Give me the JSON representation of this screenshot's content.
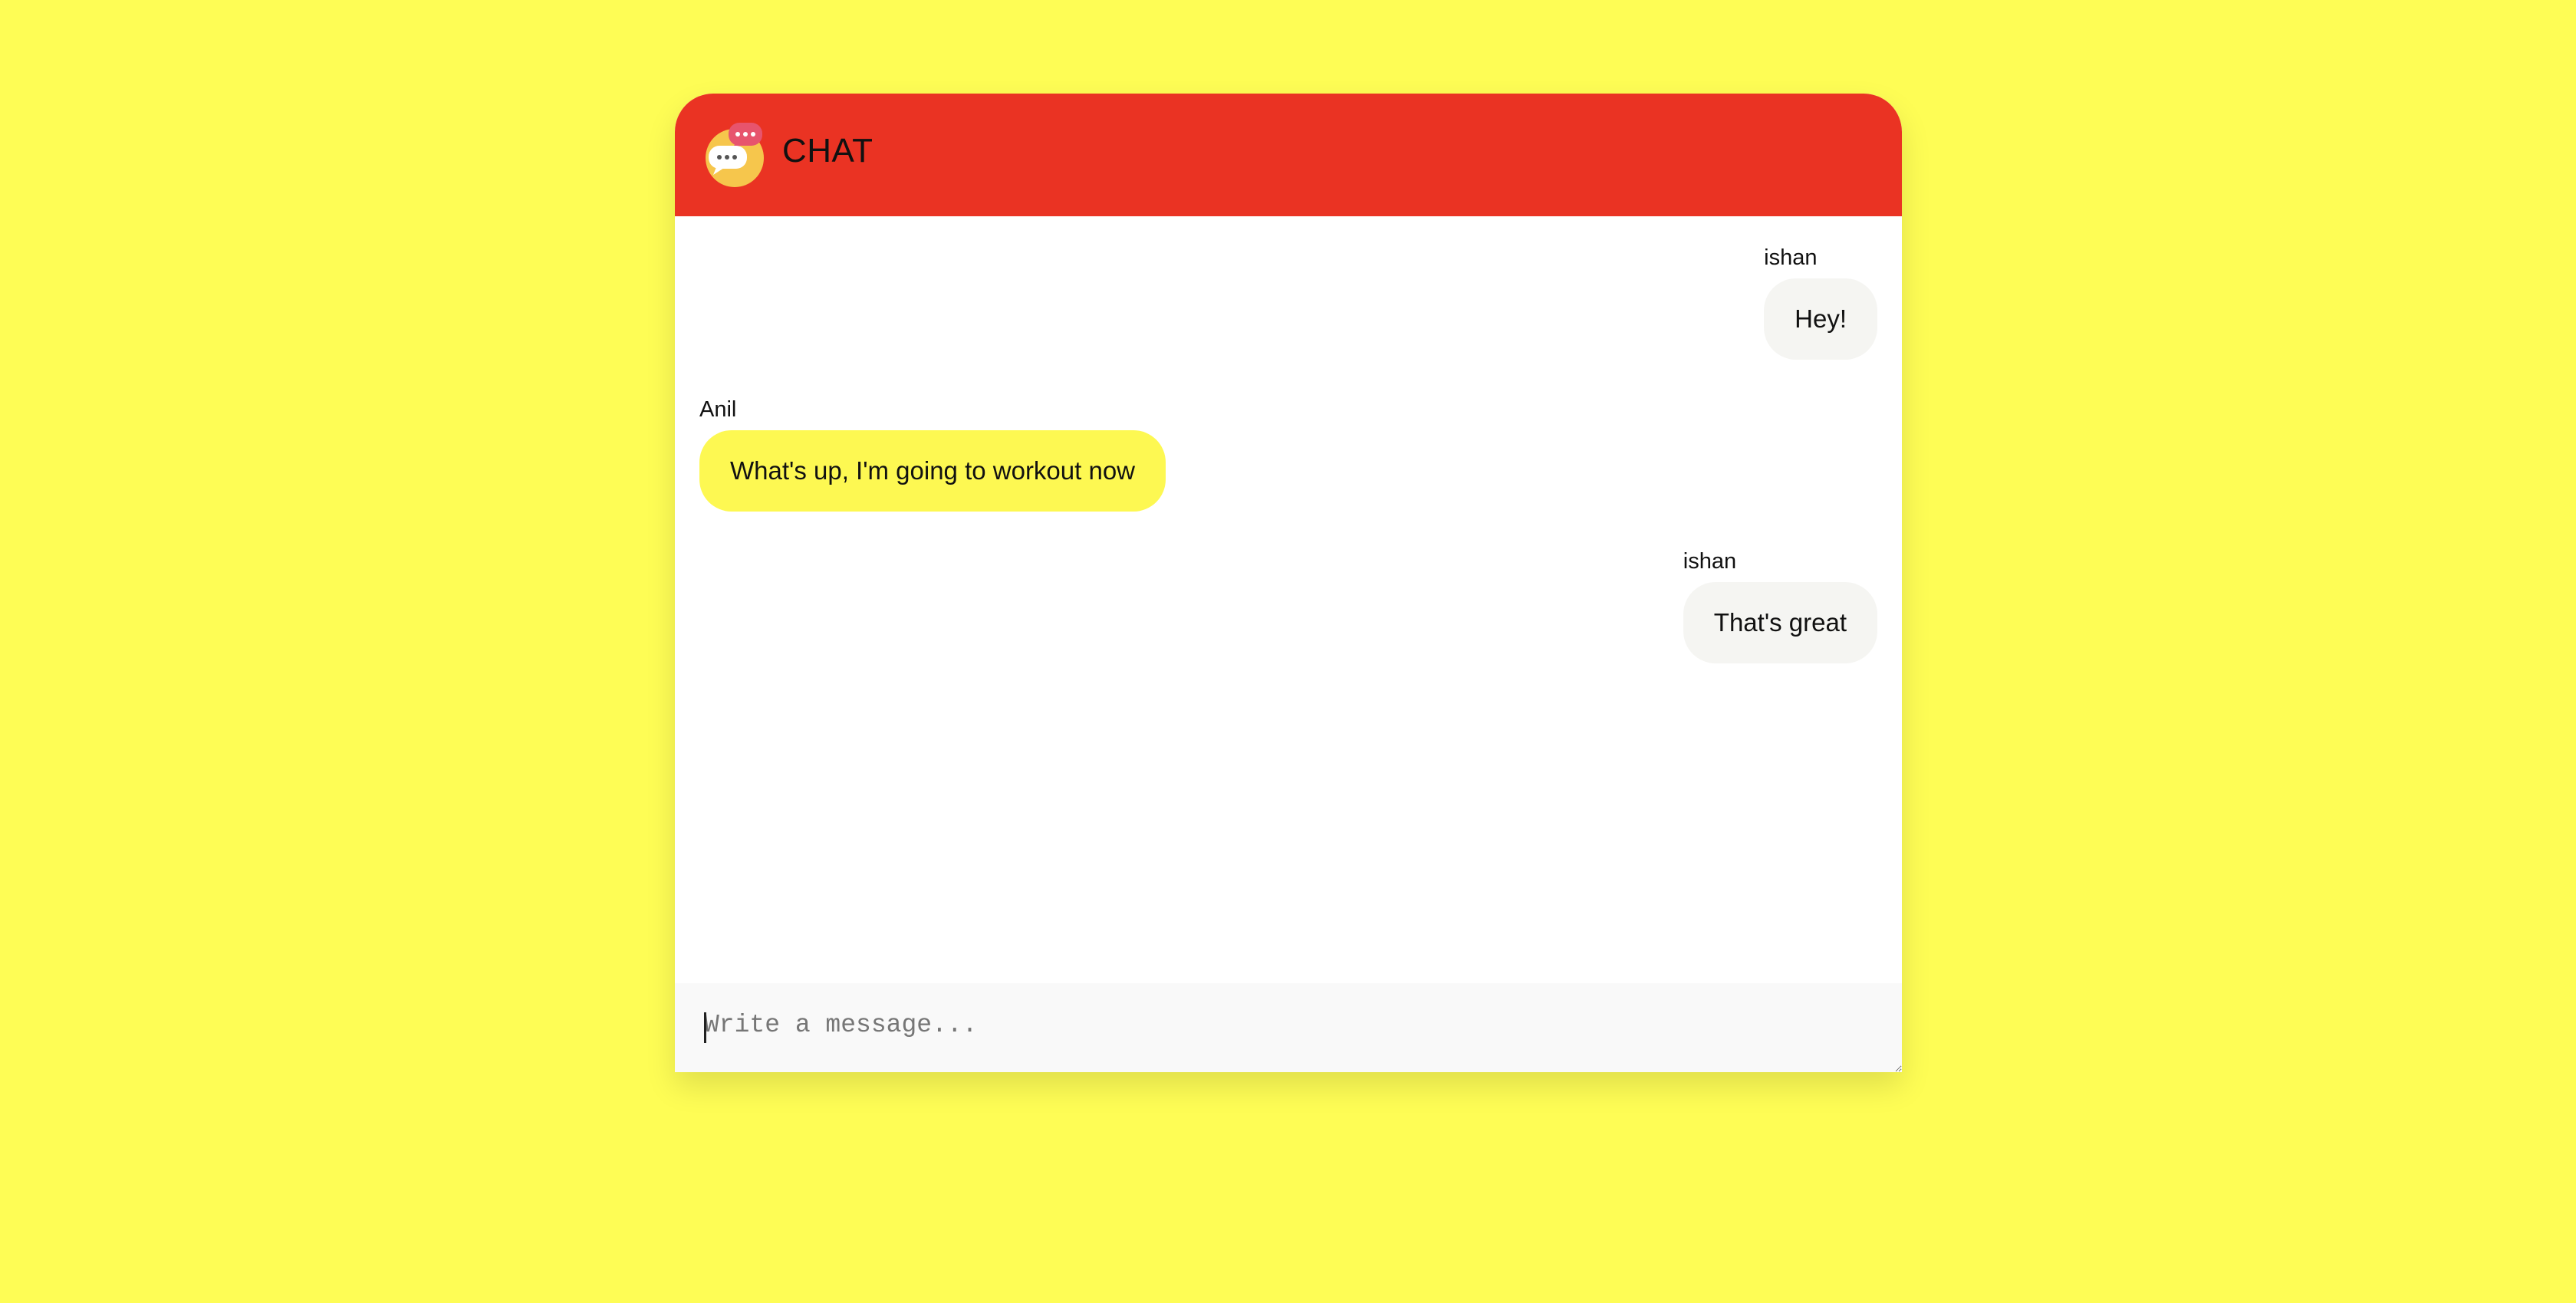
{
  "header": {
    "title": "CHAT",
    "logo_icon": "chat-bubbles-icon"
  },
  "messages": [
    {
      "author": "ishan",
      "text": "Hey!",
      "side": "self"
    },
    {
      "author": "Anil",
      "text": "What's up, I'm going to workout now",
      "side": "other"
    },
    {
      "author": "ishan",
      "text": "That's great",
      "side": "self"
    }
  ],
  "composer": {
    "placeholder": "Write a message...",
    "value": ""
  },
  "colors": {
    "page_background": "#fefd55",
    "header_background": "#ea3323",
    "self_bubble": "#f5f5f2",
    "other_bubble": "#fdf852",
    "logo_circle": "#f6c64c",
    "logo_pink_bubble": "#e7546d"
  }
}
